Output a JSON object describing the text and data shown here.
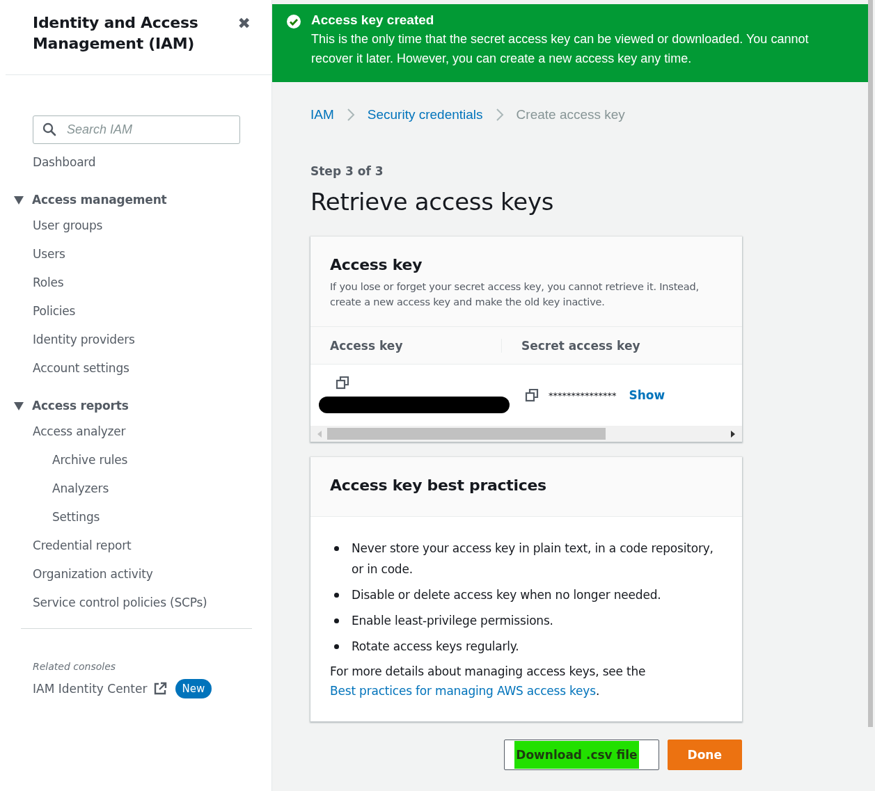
{
  "sidebar": {
    "title": "Identity and Access Management (IAM)",
    "close": "✖",
    "search": {
      "placeholder": "Search IAM"
    },
    "items": [
      {
        "label": "Dashboard",
        "selected": false
      },
      {
        "label": "Access management",
        "expanded": true,
        "children": [
          {
            "label": "User groups",
            "selected": false
          },
          {
            "label": "Users",
            "selected": false
          },
          {
            "label": "Roles",
            "selected": false
          },
          {
            "label": "Policies",
            "selected": false
          },
          {
            "label": "Identity providers",
            "selected": false
          },
          {
            "label": "Account settings",
            "selected": false
          }
        ]
      },
      {
        "label": "Access reports",
        "expanded": true,
        "children": [
          {
            "label": "Access analyzer",
            "selected": false,
            "children": [
              {
                "label": "Archive rules",
                "selected": false
              },
              {
                "label": "Analyzers",
                "selected": false
              },
              {
                "label": "Settings",
                "selected": false
              }
            ]
          },
          {
            "label": "Credential report",
            "selected": false
          },
          {
            "label": "Organization activity",
            "selected": false
          },
          {
            "label": "Service control policies (SCPs)",
            "selected": false
          }
        ]
      }
    ],
    "related": {
      "heading": "Related consoles",
      "link": "IAM Identity Center",
      "badge": "New"
    }
  },
  "banner": {
    "title": "Access key created",
    "message": "This is the only time that the secret access key can be viewed or downloaded. You cannot recover it later. However, you can create a new access key any time."
  },
  "breadcrumbs": [
    {
      "label": "IAM",
      "current": false
    },
    {
      "label": "Security credentials",
      "current": false
    },
    {
      "label": "Create access key",
      "current": true
    }
  ],
  "step": "Step 3 of 3",
  "title": "Retrieve access keys",
  "access_key_card": {
    "title": "Access key",
    "description": "If you lose or forget your secret access key, you cannot retrieve it. Instead, create a new access key and make the old key inactive.",
    "columns": [
      "Access key",
      "Secret access key"
    ],
    "secret": "***************",
    "show": "Show"
  },
  "practices_card": {
    "title": "Access key best practices",
    "bullets": [
      "Never store your access key in plain text, in a code repository, or in code.",
      "Disable or delete access key when no longer needed.",
      "Enable least-privilege permissions.",
      "Rotate access keys regularly."
    ],
    "footer": "For more details about managing access keys, see the ",
    "footer_link": "Best practices for managing AWS access keys",
    "footer_end": "."
  },
  "buttons": [
    {
      "label": "Download .csv file",
      "kind": "secondary",
      "highlighted": true
    },
    {
      "label": "Done",
      "kind": "primary",
      "highlighted": false
    }
  ]
}
